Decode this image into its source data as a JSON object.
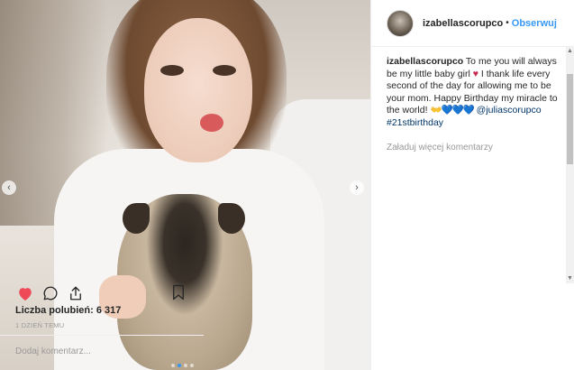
{
  "post": {
    "username": "izabellascorupco",
    "separator": "•",
    "follow_label": "Obserwuj"
  },
  "caption": {
    "author": "izabellascorupco",
    "text_part1": " To me you will always be my little baby girl ",
    "heart_emoji": "♥",
    "text_part2": " I thank life every second of the day for allowing me to be your mom. Happy Birthday my miracle to the world! ",
    "emoji_sequence": "👐💙💙💙",
    "mention": "@juliascorupco",
    "hashtag": "#21stbirthday"
  },
  "load_more_label": "Załaduj więcej komentarzy",
  "likes_label": "Liczba polubień: 6 317",
  "timestamp": "1 DZIEŃ TEMU",
  "add_comment_placeholder": "Dodaj komentarz...",
  "carousel": {
    "prev_glyph": "‹",
    "next_glyph": "›",
    "dot_count": 4,
    "active_dot": 1
  },
  "icons": {
    "like": "heart-filled-icon",
    "comment": "comment-bubble-icon",
    "share": "share-icon",
    "save": "bookmark-icon"
  },
  "colors": {
    "like_red": "#ed4956",
    "link_blue": "#3897f0",
    "text": "#262626",
    "muted": "#999999"
  }
}
